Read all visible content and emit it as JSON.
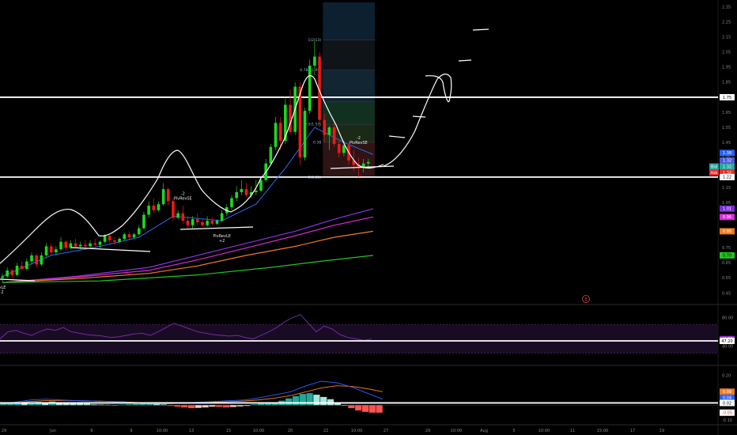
{
  "chart_data": {
    "type": "candlestick",
    "price_pane": {
      "y_ticks": [
        "2.35",
        "2.25",
        "2.15",
        "2.05",
        "1.95",
        "1.85",
        "1.75",
        "1.65",
        "1.55",
        "1.45",
        "1.35",
        "1.25",
        "1.15",
        "1.05",
        "0.95",
        "0.85",
        "0.75",
        "0.65",
        "0.55",
        "0.45"
      ],
      "levels": [
        1.75,
        1.22
      ],
      "price_badges": [
        {
          "label": "",
          "value": "1.75",
          "price": 1.75,
          "color": "#ffffff",
          "text_color": "#000000"
        },
        {
          "label": "",
          "value": "1.38",
          "price": 1.38,
          "color": "#2962ff",
          "text_color": "#ffffff"
        },
        {
          "label": "",
          "value": "1.32",
          "price": 1.33,
          "color": "#4c5bd4",
          "text_color": "#ffffff"
        },
        {
          "label": "Bid",
          "value": "1.32",
          "price": 1.29,
          "color": "#26a69a",
          "text_color": "#ffffff"
        },
        {
          "label": "Ask",
          "value": "1.32",
          "price": 1.25,
          "color": "#ef2a2a",
          "text_color": "#ffffff"
        },
        {
          "label": "",
          "value": "1.22",
          "price": 1.22,
          "color": "#ffffff",
          "text_color": "#000000"
        },
        {
          "label": "",
          "value": "1.01",
          "price": 1.01,
          "color": "#7b2fd6",
          "text_color": "#ffffff"
        },
        {
          "label": "",
          "value": "0.96",
          "price": 0.955,
          "color": "#d62fd6",
          "text_color": "#ffffff"
        },
        {
          "label": "",
          "value": "0.86",
          "price": 0.86,
          "color": "#f27a1f",
          "text_color": "#ffffff"
        },
        {
          "label": "",
          "value": "0.70",
          "price": 0.7,
          "color": "#22c51f",
          "text_color": "#000000"
        }
      ],
      "fib_labels": [
        {
          "text": "1(2.13)",
          "price": 2.13
        },
        {
          "text": "0.786(1.93)",
          "price": 1.93
        },
        {
          "text": "0.5(1.57)",
          "price": 1.57
        },
        {
          "text": "0.38",
          "price": 1.45
        },
        {
          "text": "0(1.22)",
          "price": 1.22
        }
      ],
      "signals": [
        {
          "text": "PivRevSE",
          "num": "-2",
          "x_index": 73,
          "price": 1.44,
          "position": "above"
        },
        {
          "text": "PivRevSE",
          "num": "-2",
          "x_index": 37,
          "price": 1.07,
          "position": "above"
        },
        {
          "text": "PivRevLE",
          "num": "+2",
          "x_index": 45,
          "price": 0.82,
          "position": "below"
        },
        {
          "text": "vLE",
          "num": "2",
          "x_index": 0,
          "price": 0.48,
          "position": "below"
        }
      ],
      "ohlc": [
        [
          0.55,
          0.58,
          0.52,
          0.56
        ],
        [
          0.56,
          0.62,
          0.55,
          0.6
        ],
        [
          0.6,
          0.61,
          0.55,
          0.57
        ],
        [
          0.57,
          0.65,
          0.56,
          0.63
        ],
        [
          0.63,
          0.66,
          0.6,
          0.61
        ],
        [
          0.61,
          0.68,
          0.6,
          0.66
        ],
        [
          0.66,
          0.72,
          0.64,
          0.7
        ],
        [
          0.7,
          0.71,
          0.62,
          0.64
        ],
        [
          0.64,
          0.72,
          0.63,
          0.7
        ],
        [
          0.7,
          0.78,
          0.69,
          0.76
        ],
        [
          0.76,
          0.78,
          0.7,
          0.72
        ],
        [
          0.72,
          0.76,
          0.7,
          0.74
        ],
        [
          0.74,
          0.82,
          0.73,
          0.79
        ],
        [
          0.79,
          0.8,
          0.73,
          0.75
        ],
        [
          0.75,
          0.8,
          0.74,
          0.78
        ],
        [
          0.78,
          0.81,
          0.75,
          0.76
        ],
        [
          0.76,
          0.79,
          0.74,
          0.77
        ],
        [
          0.77,
          0.8,
          0.75,
          0.76
        ],
        [
          0.76,
          0.8,
          0.75,
          0.78
        ],
        [
          0.78,
          0.81,
          0.76,
          0.77
        ],
        [
          0.77,
          0.8,
          0.75,
          0.79
        ],
        [
          0.79,
          0.84,
          0.78,
          0.83
        ],
        [
          0.83,
          0.84,
          0.78,
          0.8
        ],
        [
          0.8,
          0.82,
          0.77,
          0.79
        ],
        [
          0.79,
          0.82,
          0.78,
          0.81
        ],
        [
          0.81,
          0.85,
          0.8,
          0.84
        ],
        [
          0.84,
          0.86,
          0.8,
          0.82
        ],
        [
          0.82,
          0.85,
          0.81,
          0.84
        ],
        [
          0.84,
          0.9,
          0.83,
          0.88
        ],
        [
          0.88,
          0.99,
          0.87,
          0.97
        ],
        [
          0.97,
          1.06,
          0.95,
          1.03
        ],
        [
          1.03,
          1.08,
          0.98,
          1.0
        ],
        [
          1.0,
          1.06,
          0.99,
          1.04
        ],
        [
          1.04,
          1.18,
          1.03,
          1.14
        ],
        [
          1.14,
          1.15,
          1.03,
          1.06
        ],
        [
          1.06,
          1.08,
          0.93,
          0.95
        ],
        [
          0.95,
          1.0,
          0.94,
          0.98
        ],
        [
          0.98,
          1.03,
          0.91,
          0.93
        ],
        [
          0.93,
          0.96,
          0.88,
          0.9
        ],
        [
          0.9,
          0.96,
          0.88,
          0.94
        ],
        [
          0.94,
          0.98,
          0.9,
          0.92
        ],
        [
          0.92,
          0.94,
          0.89,
          0.9
        ],
        [
          0.9,
          0.96,
          0.89,
          0.93
        ],
        [
          0.93,
          0.95,
          0.9,
          0.91
        ],
        [
          0.91,
          0.94,
          0.9,
          0.93
        ],
        [
          0.93,
          1.0,
          0.92,
          0.98
        ],
        [
          0.98,
          1.04,
          0.96,
          1.02
        ],
        [
          1.02,
          1.1,
          1.0,
          1.08
        ],
        [
          1.08,
          1.16,
          1.06,
          1.12
        ],
        [
          1.12,
          1.2,
          1.1,
          1.14
        ],
        [
          1.14,
          1.18,
          1.09,
          1.1
        ],
        [
          1.1,
          1.16,
          1.08,
          1.12
        ],
        [
          1.12,
          1.2,
          1.1,
          1.13
        ],
        [
          1.13,
          1.22,
          1.12,
          1.2
        ],
        [
          1.2,
          1.34,
          1.19,
          1.31
        ],
        [
          1.31,
          1.44,
          1.3,
          1.42
        ],
        [
          1.42,
          1.62,
          1.4,
          1.58
        ],
        [
          1.58,
          1.62,
          1.4,
          1.46
        ],
        [
          1.46,
          1.74,
          1.44,
          1.7
        ],
        [
          1.7,
          1.8,
          1.5,
          1.52
        ],
        [
          1.52,
          1.85,
          1.5,
          1.82
        ],
        [
          1.82,
          1.85,
          1.3,
          1.35
        ],
        [
          1.35,
          1.68,
          1.33,
          1.66
        ],
        [
          1.66,
          2.0,
          1.64,
          1.96
        ],
        [
          1.96,
          2.14,
          1.9,
          2.02
        ],
        [
          2.02,
          2.05,
          1.55,
          1.6
        ],
        [
          1.6,
          1.64,
          1.45,
          1.5
        ],
        [
          1.5,
          1.56,
          1.4,
          1.55
        ],
        [
          1.55,
          1.58,
          1.42,
          1.44
        ],
        [
          1.44,
          1.47,
          1.35,
          1.38
        ],
        [
          1.38,
          1.46,
          1.36,
          1.43
        ],
        [
          1.43,
          1.45,
          1.3,
          1.33
        ],
        [
          1.33,
          1.4,
          1.26,
          1.3
        ],
        [
          1.3,
          1.35,
          1.22,
          1.28
        ],
        [
          1.28,
          1.34,
          1.25,
          1.31
        ],
        [
          1.31,
          1.34,
          1.28,
          1.32
        ]
      ],
      "ma_series": [
        {
          "color": "#2a6cf0",
          "points": [
            [
              0,
              0.56
            ],
            [
              10,
              0.7
            ],
            [
              20,
              0.76
            ],
            [
              28,
              0.82
            ],
            [
              35,
              0.96
            ],
            [
              45,
              0.93
            ],
            [
              52,
              1.04
            ],
            [
              58,
              1.28
            ],
            [
              64,
              1.55
            ],
            [
              70,
              1.45
            ],
            [
              76,
              1.37
            ]
          ]
        },
        {
          "color": "#8a34e0",
          "points": [
            [
              0,
              0.52
            ],
            [
              15,
              0.56
            ],
            [
              30,
              0.62
            ],
            [
              40,
              0.7
            ],
            [
              50,
              0.78
            ],
            [
              60,
              0.86
            ],
            [
              68,
              0.94
            ],
            [
              76,
              1.01
            ]
          ]
        },
        {
          "color": "#d62fd6",
          "points": [
            [
              0,
              0.52
            ],
            [
              15,
              0.555
            ],
            [
              30,
              0.6
            ],
            [
              40,
              0.67
            ],
            [
              50,
              0.75
            ],
            [
              60,
              0.83
            ],
            [
              68,
              0.9
            ],
            [
              76,
              0.955
            ]
          ]
        },
        {
          "color": "#f27a1f",
          "points": [
            [
              0,
              0.52
            ],
            [
              15,
              0.545
            ],
            [
              30,
              0.58
            ],
            [
              40,
              0.63
            ],
            [
              50,
              0.7
            ],
            [
              60,
              0.76
            ],
            [
              68,
              0.82
            ],
            [
              76,
              0.86
            ]
          ]
        },
        {
          "color": "#22c51f",
          "points": [
            [
              0,
              0.52
            ],
            [
              20,
              0.53
            ],
            [
              40,
              0.57
            ],
            [
              55,
              0.62
            ],
            [
              65,
              0.66
            ],
            [
              76,
              0.7
            ]
          ]
        }
      ]
    },
    "oscillator_pane": {
      "y_ticks": [
        "80.00",
        "40.00"
      ],
      "badges": [
        {
          "value": "49.73",
          "level": 49.73,
          "color": "#9b2fd6",
          "text_color": "#ffffff"
        },
        {
          "value": "47.20",
          "level": 47.2,
          "color": "#ffffff",
          "text_color": "#000000"
        }
      ],
      "upper_band": 70,
      "lower_band": 30,
      "ylim": [
        15,
        95
      ],
      "values": [
        50,
        60,
        62,
        58,
        55,
        60,
        64,
        62,
        66,
        60,
        58,
        56,
        55,
        54,
        52,
        53,
        55,
        57,
        58,
        55,
        60,
        66,
        72,
        68,
        64,
        60,
        58,
        56,
        55,
        54,
        55,
        52,
        50,
        55,
        60,
        66,
        74,
        80,
        84,
        72,
        60,
        68,
        64,
        56,
        52,
        50,
        48,
        49.73
      ]
    },
    "macd_pane": {
      "y_ticks": [
        "0.20",
        "0.10",
        "-0.10"
      ],
      "badges": [
        {
          "value": "0.09",
          "level": 0.09,
          "color": "#f27a1f",
          "text_color": "#ffffff"
        },
        {
          "value": "0.04",
          "level": 0.05,
          "color": "#2962ff",
          "text_color": "#ffffff"
        },
        {
          "value": "0.02",
          "level": 0.015,
          "color": "#ffffff",
          "text_color": "#000000"
        },
        {
          "value": "-0.05",
          "level": -0.05,
          "color": "#ffffff",
          "text_color": "#e53935"
        }
      ],
      "ylim": [
        -0.12,
        0.25
      ],
      "histogram": [
        0.01,
        0.015,
        0.02,
        0.018,
        0.02,
        0.022,
        0.02,
        0.025,
        0.02,
        0.018,
        0.015,
        0.012,
        0.01,
        0.005,
        0.004,
        0.003,
        0.002,
        0.004,
        0.006,
        0.008,
        0.01,
        0.012,
        0.01,
        0.005,
        -0.005,
        -0.01,
        -0.015,
        -0.02,
        -0.018,
        -0.015,
        -0.01,
        -0.012,
        -0.015,
        -0.012,
        -0.008,
        -0.005,
        0.005,
        0.01,
        0.015,
        0.02,
        0.03,
        0.045,
        0.06,
        0.075,
        0.08,
        0.07,
        0.055,
        0.04,
        0.02,
        0.0,
        -0.02,
        -0.035,
        -0.045,
        -0.05,
        -0.05
      ],
      "macd_line": [
        0.01,
        0.02,
        0.035,
        0.04,
        0.035,
        0.03,
        0.028,
        0.025,
        0.02,
        0.015,
        0.01,
        0.01,
        0.015,
        0.02,
        0.025,
        0.03,
        0.035,
        0.05,
        0.07,
        0.09,
        0.13,
        0.16,
        0.15,
        0.12,
        0.08,
        0.04
      ],
      "signal_line": [
        0.008,
        0.015,
        0.025,
        0.03,
        0.032,
        0.03,
        0.028,
        0.026,
        0.022,
        0.018,
        0.014,
        0.012,
        0.013,
        0.016,
        0.02,
        0.024,
        0.028,
        0.036,
        0.048,
        0.064,
        0.09,
        0.115,
        0.13,
        0.125,
        0.11,
        0.09
      ]
    },
    "x_ticks": [
      "29",
      "Jun",
      "6",
      "9",
      "10:00",
      "13",
      "15",
      "10:00",
      "20",
      "22",
      "10:00",
      "27",
      "29",
      "10:00",
      "Aug",
      "5",
      "10:00",
      "11",
      "15:00",
      "17",
      "19"
    ]
  },
  "icons": {
    "earnings_marker": "E"
  }
}
